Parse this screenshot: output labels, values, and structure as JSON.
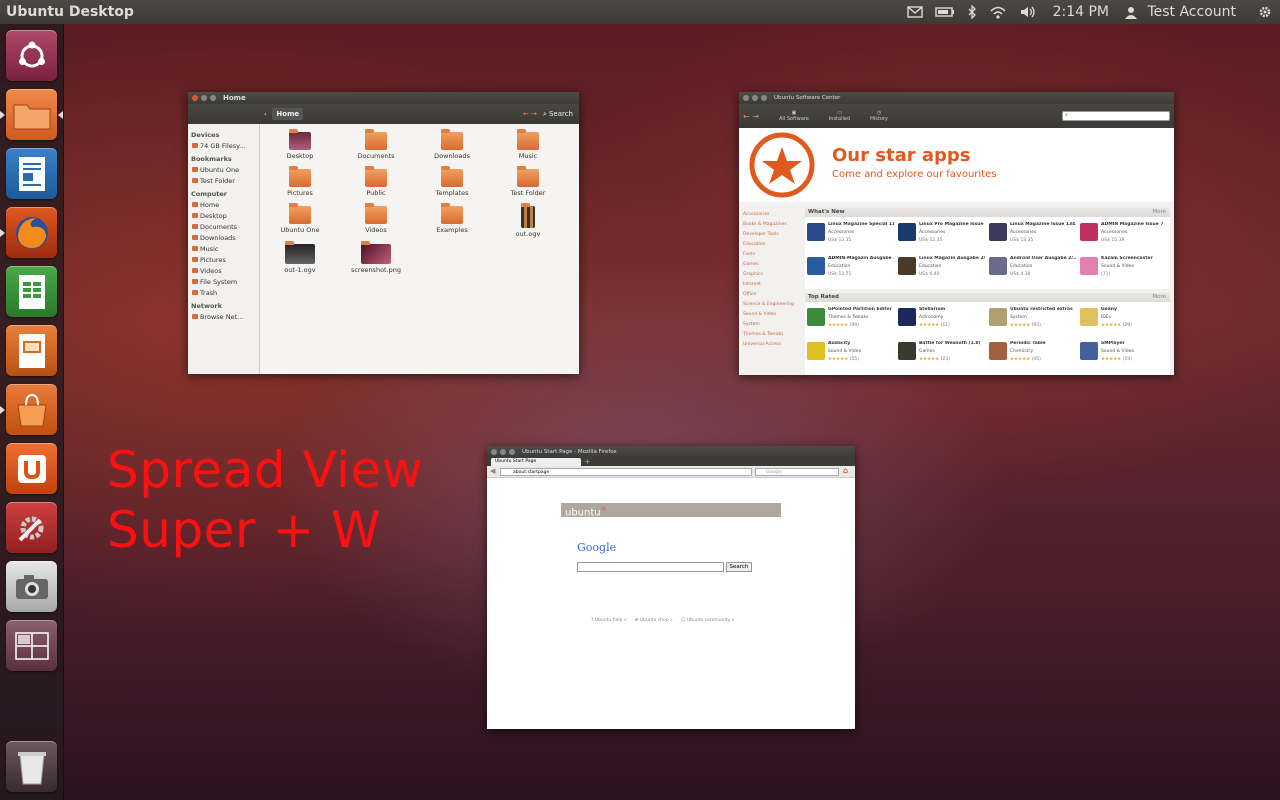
{
  "topbar": {
    "title": "Ubuntu Desktop",
    "time": "2:14 PM",
    "user": "Test Account"
  },
  "overlay": {
    "line1": "Spread View",
    "line2": "Super + W"
  },
  "launcher": {
    "items": [
      "Dash Home",
      "Home Folder",
      "LibreOffice Writer",
      "Firefox Web Browser",
      "LibreOffice Calc",
      "LibreOffice Impress",
      "Ubuntu Software Center",
      "Ubuntu One",
      "System Settings",
      "Shotwell",
      "Workspace Switcher",
      "Trash"
    ]
  },
  "nautilus": {
    "title": "Home",
    "crumb": "Home",
    "search": "Search",
    "sidebar": {
      "devices": "Devices",
      "devices_items": [
        "74 GB Filesy..."
      ],
      "bookmarks": "Bookmarks",
      "bookmarks_items": [
        "Ubuntu One",
        "Test Folder"
      ],
      "computer": "Computer",
      "computer_items": [
        "Home",
        "Desktop",
        "Documents",
        "Downloads",
        "Music",
        "Pictures",
        "Videos",
        "File System",
        "Trash"
      ],
      "network": "Network",
      "network_items": [
        "Browse Net..."
      ]
    },
    "files": [
      "Desktop",
      "Documents",
      "Downloads",
      "Music",
      "Pictures",
      "Public",
      "Templates",
      "Test Folder",
      "Ubuntu One",
      "Videos",
      "Examples",
      "out.ogv",
      "out-1.ogv",
      "screenshot.png"
    ]
  },
  "software": {
    "title": "Ubuntu Software Center",
    "tools": [
      "All Software",
      "Installed",
      "History"
    ],
    "banner_title": "Our star apps",
    "banner_sub": "Come and explore our favourites",
    "categories": [
      "Accessories",
      "Books & Magazines",
      "Developer Tools",
      "Education",
      "Fonts",
      "Games",
      "Graphics",
      "Internet",
      "Office",
      "Science & Engineering",
      "Sound & Video",
      "System",
      "Themes & Tweaks",
      "Universal Access"
    ],
    "whats_new": "What's New",
    "top_rated": "Top Rated",
    "more": "More",
    "new_apps": [
      {
        "name": "Linux Magazine Special 11",
        "cat": "Accessories",
        "price": "US$ 13.35"
      },
      {
        "name": "Linux Pro Magazine Issue ...",
        "cat": "Accessories",
        "price": "US$ 12.35"
      },
      {
        "name": "Linux Magazine Issue 134 ...",
        "cat": "Accessories",
        "price": "US$ 13.35"
      },
      {
        "name": "ADMIN Magazine Issue 7",
        "cat": "Accessories",
        "price": "US$ 15.39"
      },
      {
        "name": "ADMIN-Magazin Ausgabe ...",
        "cat": "Education",
        "price": "US$ 13.75"
      },
      {
        "name": "Linux Magazin Ausgabe 2/...",
        "cat": "Education",
        "price": "US$ 6.40"
      },
      {
        "name": "Android User Ausgabe 2/...",
        "cat": "Education",
        "price": "US$ 4.30"
      },
      {
        "name": "Kazam Screencaster",
        "cat": "Sound & Video",
        "price": "(71)"
      }
    ],
    "top_apps": [
      {
        "name": "GPointed Partition Editor",
        "cat": "Themes & Tweaks",
        "rating": "(99)",
        "price": "Free"
      },
      {
        "name": "Stellarium",
        "cat": "Astronomy",
        "rating": "(61)",
        "price": "Free"
      },
      {
        "name": "Ubuntu restricted extras",
        "cat": "System",
        "rating": "(93)",
        "price": "Free"
      },
      {
        "name": "Geany",
        "cat": "IDEs",
        "rating": "(29)",
        "price": "Free"
      },
      {
        "name": "Audacity",
        "cat": "Sound & Video",
        "rating": "(55)",
        "price": "Free"
      },
      {
        "name": "Battle for Wesnoth (1.8)",
        "cat": "Games",
        "rating": "(23)",
        "price": "Free"
      },
      {
        "name": "Periodic Table",
        "cat": "Chemistry",
        "rating": "(45)",
        "price": "Free"
      },
      {
        "name": "SMPlayer",
        "cat": "Sound & Video",
        "rating": "(19)",
        "price": "Free"
      }
    ]
  },
  "firefox": {
    "title": "Ubuntu Start Page - Mozilla Firefox",
    "tab": "Ubuntu Start Page",
    "url": "about:startpage",
    "search_placeholder": "Google",
    "brand": "ubuntu",
    "google": "Google",
    "search_btn": "Search",
    "links": [
      "Ubuntu help »",
      "Ubuntu shop »",
      "Ubuntu community »"
    ]
  }
}
